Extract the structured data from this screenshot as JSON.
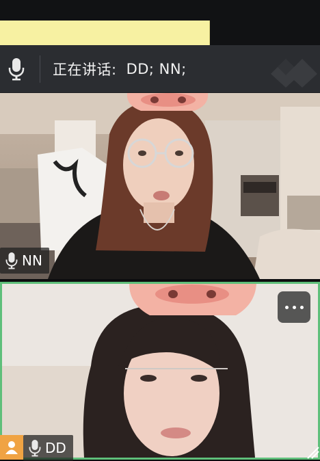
{
  "speaker_bar": {
    "label": "正在讲话:",
    "names": "DD; NN;",
    "icon": "microphone-icon"
  },
  "tiles": [
    {
      "name": "NN",
      "mic_icon": "microphone-icon",
      "border_color": ""
    },
    {
      "name": "DD",
      "mic_icon": "microphone-icon",
      "active_speaker_border": "#5fbf7a",
      "host_icon": "person-icon",
      "menu_icon": "more-icon"
    }
  ],
  "colors": {
    "speaker_bar_bg": "#2b2d31",
    "active_border": "#5fbf7a",
    "host_badge": "#f0a343",
    "note": "#f7f1a2"
  }
}
